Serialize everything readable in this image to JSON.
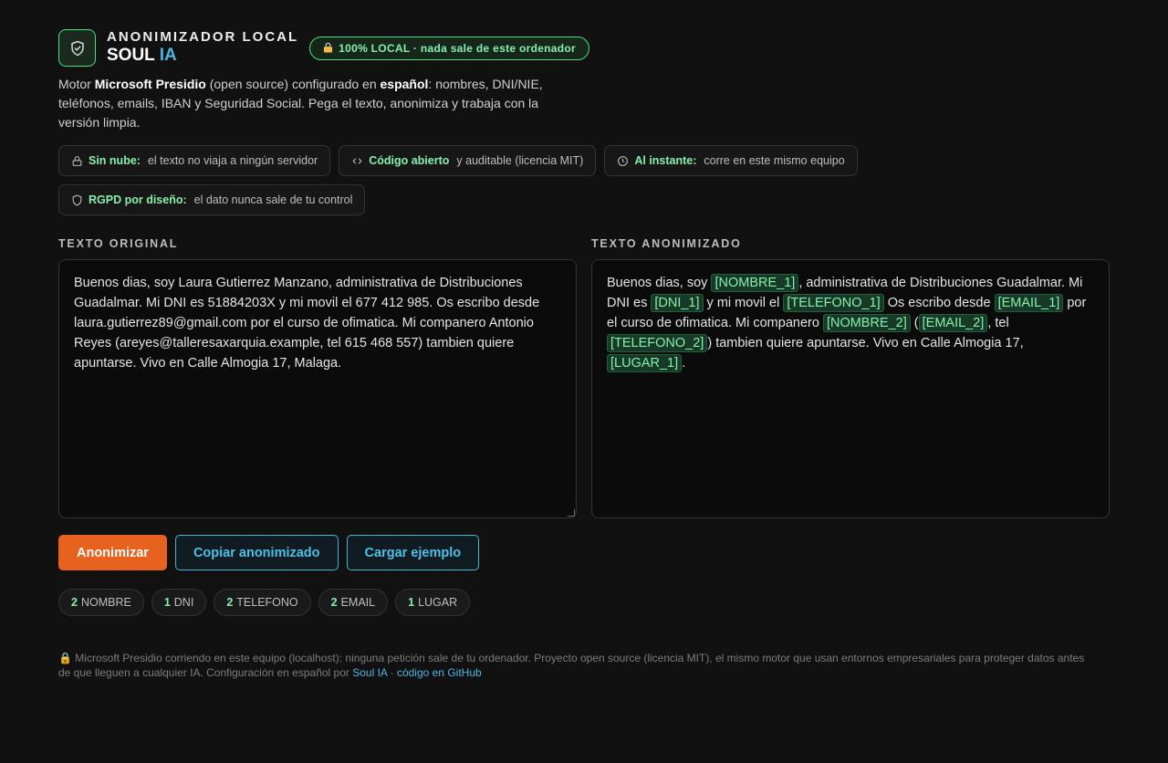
{
  "header": {
    "eyebrow": "ANONIMIZADOR LOCAL",
    "brand_main": "SOUL",
    "brand_accent": "IA",
    "local_badge": "100% LOCAL · nada sale de este ordenador",
    "logo_icon": "shield-check-icon",
    "badge_icon": "lock-icon"
  },
  "description": {
    "p1": "Motor ",
    "engine": "Microsoft Presidio",
    "p2": " (open source) configurado en ",
    "language": "español",
    "p3": ": nombres, DNI/NIE, teléfonos, emails, IBAN y Seguridad Social. Pega el texto, anonimiza y trabaja con la versión limpia."
  },
  "features": [
    {
      "icon": "lock-icon",
      "title": "Sin nube:",
      "text": "el texto no viaja a ningún servidor"
    },
    {
      "icon": "code-icon",
      "title": "Código abierto",
      "text": "y auditable (licencia MIT)"
    },
    {
      "icon": "clock-icon",
      "title": "Al instante:",
      "text": "corre en este mismo equipo"
    },
    {
      "icon": "shield-icon",
      "title": "RGPD por diseño:",
      "text": "el dato nunca sale de tu control"
    }
  ],
  "original": {
    "label": "TEXTO ORIGINAL",
    "value": "Buenos dias, soy Laura Gutierrez Manzano, administrativa de Distribuciones Guadalmar. Mi DNI es 51884203X y mi movil el 677 412 985. Os escribo desde laura.gutierrez89@gmail.com por el curso de ofimatica. Mi companero Antonio Reyes (areyes@talleresaxarquia.example, tel 615 468 557) tambien quiere apuntarse. Vivo en Calle Almogia 17, Malaga."
  },
  "anonymized": {
    "label": "TEXTO ANONIMIZADO",
    "segments": [
      {
        "t": "Buenos dias, soy "
      },
      {
        "tag": "[NOMBRE_1]"
      },
      {
        "t": ", administrativa de Distribuciones Guadalmar. Mi DNI es "
      },
      {
        "tag": "[DNI_1]"
      },
      {
        "t": " y mi movil el "
      },
      {
        "tag": "[TELEFONO_1]"
      },
      {
        "t": " Os escribo desde "
      },
      {
        "tag": "[EMAIL_1]"
      },
      {
        "t": " por el curso de ofimatica. Mi companero "
      },
      {
        "tag": "[NOMBRE_2]"
      },
      {
        "t": " ("
      },
      {
        "tag": "[EMAIL_2]"
      },
      {
        "t": ", tel "
      },
      {
        "tag": "[TELEFONO_2]"
      },
      {
        "t": ") tambien quiere apuntarse. Vivo en Calle Almogia 17, "
      },
      {
        "tag": "[LUGAR_1]"
      },
      {
        "t": "."
      }
    ]
  },
  "actions": {
    "anonymize": "Anonimizar",
    "copy": "Copiar anonimizado",
    "load_example": "Cargar ejemplo"
  },
  "counts": [
    {
      "n": "2",
      "label": "NOMBRE"
    },
    {
      "n": "1",
      "label": "DNI"
    },
    {
      "n": "2",
      "label": "TELEFONO"
    },
    {
      "n": "2",
      "label": "EMAIL"
    },
    {
      "n": "1",
      "label": "LUGAR"
    }
  ],
  "footer": {
    "emoji": "🔒",
    "text": " Microsoft Presidio corriendo en este equipo (localhost): ninguna petición sale de tu ordenador. Proyecto open source (licencia MIT), el mismo motor que usan entornos empresariales para proteger datos antes de que lleguen a cualquier IA. Configuración en español por ",
    "link1": "Soul IA",
    "sep": " · ",
    "link2": "código en GitHub"
  },
  "colors": {
    "background": "#111111",
    "accent_green": "#4ade80",
    "accent_orange": "#e8621f",
    "accent_cyan": "#3fb3d9"
  }
}
